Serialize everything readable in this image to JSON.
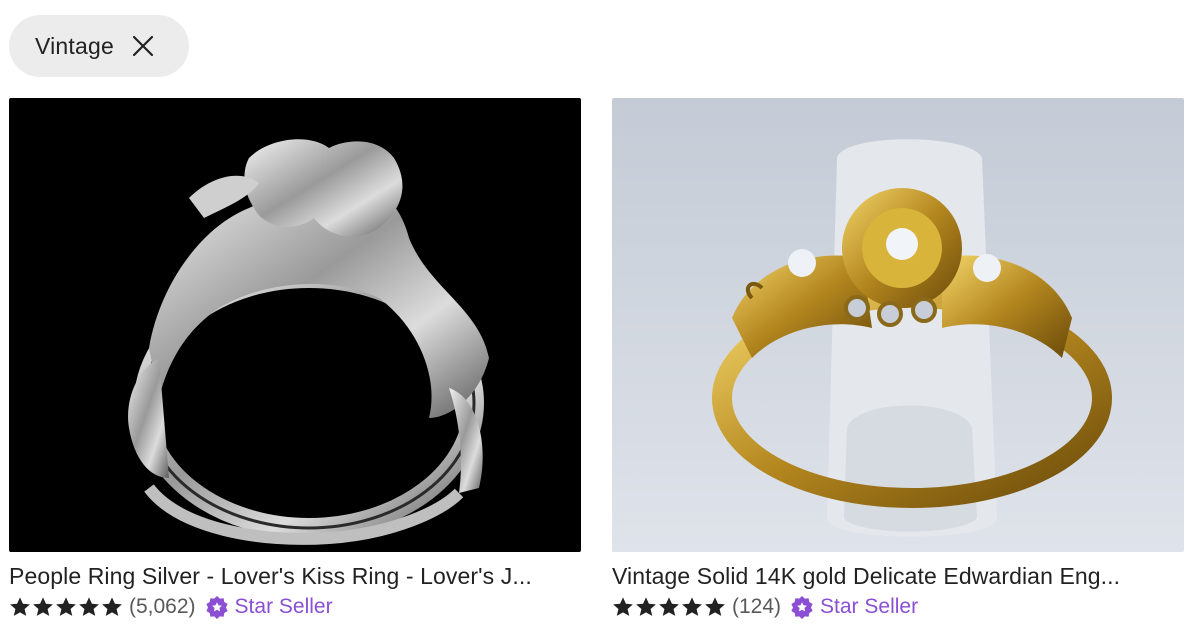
{
  "filter_chip": {
    "label": "Vintage",
    "icon": "close-icon"
  },
  "listings": [
    {
      "title": "People Ring Silver - Lover's Kiss Ring - Lover's J...",
      "rating": 5,
      "review_count": "(5,062)",
      "badge_label": "Star Seller",
      "image": "silver-lovers-ring-on-black"
    },
    {
      "title": "Vintage Solid 14K gold Delicate Edwardian Eng...",
      "rating": 5,
      "review_count": "(124)",
      "badge_label": "Star Seller",
      "image": "gold-diamond-ring-on-grey-stand"
    }
  ],
  "colors": {
    "star_seller": "#8a4fd3",
    "chip_bg": "#ececec",
    "text": "#222222"
  }
}
